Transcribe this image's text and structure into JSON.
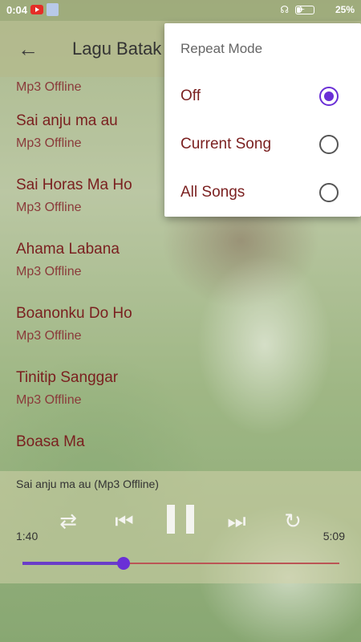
{
  "status_bar": {
    "time": "0:04",
    "battery": "25%",
    "battery_level": 0.25,
    "icons": [
      "youtube-icon",
      "app-icon",
      "headphones-icon",
      "airplane-icon",
      "battery-icon"
    ]
  },
  "toolbar": {
    "back_icon": "arrow-left-icon",
    "title": "Lagu Batak"
  },
  "songs": [
    {
      "title": "",
      "subtitle": "Mp3 Offline"
    },
    {
      "title": "Sai anju ma au",
      "subtitle": "Mp3 Offline"
    },
    {
      "title": "Sai Horas Ma Ho",
      "subtitle": "Mp3 Offline"
    },
    {
      "title": "Ahama Labana",
      "subtitle": "Mp3 Offline"
    },
    {
      "title": "Boanonku Do Ho",
      "subtitle": "Mp3 Offline"
    },
    {
      "title": "Tinitip Sanggar",
      "subtitle": "Mp3 Offline"
    },
    {
      "title": "Boasa Ma",
      "subtitle": ""
    }
  ],
  "player": {
    "now_playing": "Sai anju ma au (Mp3 Offline)",
    "elapsed": "1:40",
    "duration": "5:09",
    "progress": 0.32,
    "controls": [
      "shuffle-icon",
      "previous-icon",
      "pause-icon",
      "next-icon",
      "repeat-icon"
    ]
  },
  "repeat_menu": {
    "title": "Repeat Mode",
    "options": [
      {
        "label": "Off",
        "selected": true
      },
      {
        "label": "Current Song",
        "selected": false
      },
      {
        "label": "All Songs",
        "selected": false
      }
    ]
  },
  "colors": {
    "accent": "#6a2fd6",
    "song_text": "#7a1f1f"
  }
}
